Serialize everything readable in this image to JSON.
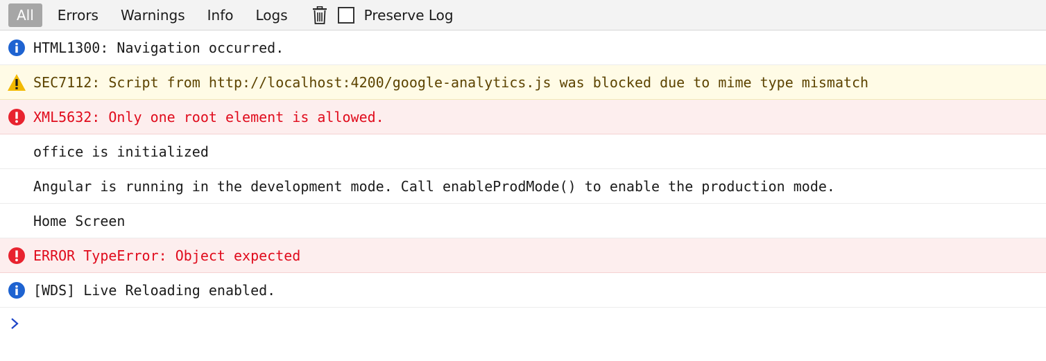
{
  "toolbar": {
    "filters": [
      "All",
      "Errors",
      "Warnings",
      "Info",
      "Logs"
    ],
    "active_filter": "All",
    "clear_icon": "trash-icon",
    "preserve_log_label": "Preserve Log",
    "preserve_log_checked": false
  },
  "colors": {
    "info": "#1e63d1",
    "warning": "#f2b900",
    "error": "#e8232f",
    "error_text": "#e00b1c",
    "prompt": "#1d45c8"
  },
  "messages": [
    {
      "level": "info",
      "icon": "info-icon",
      "text": "HTML1300: Navigation occurred."
    },
    {
      "level": "warn",
      "icon": "warning-icon",
      "text": "SEC7112: Script from http://localhost:4200/google-analytics.js was blocked due to mime type mismatch"
    },
    {
      "level": "error",
      "icon": "error-icon",
      "text": "XML5632: Only one root element is allowed."
    },
    {
      "level": "log",
      "icon": "",
      "text": "office is initialized"
    },
    {
      "level": "log",
      "icon": "",
      "text": "Angular is running in the development mode. Call enableProdMode() to enable the production mode."
    },
    {
      "level": "log",
      "icon": "",
      "text": "Home Screen"
    },
    {
      "level": "error",
      "icon": "error-icon",
      "text": "ERROR TypeError: Object expected"
    },
    {
      "level": "info",
      "icon": "info-icon",
      "text": "[WDS] Live Reloading enabled."
    }
  ]
}
